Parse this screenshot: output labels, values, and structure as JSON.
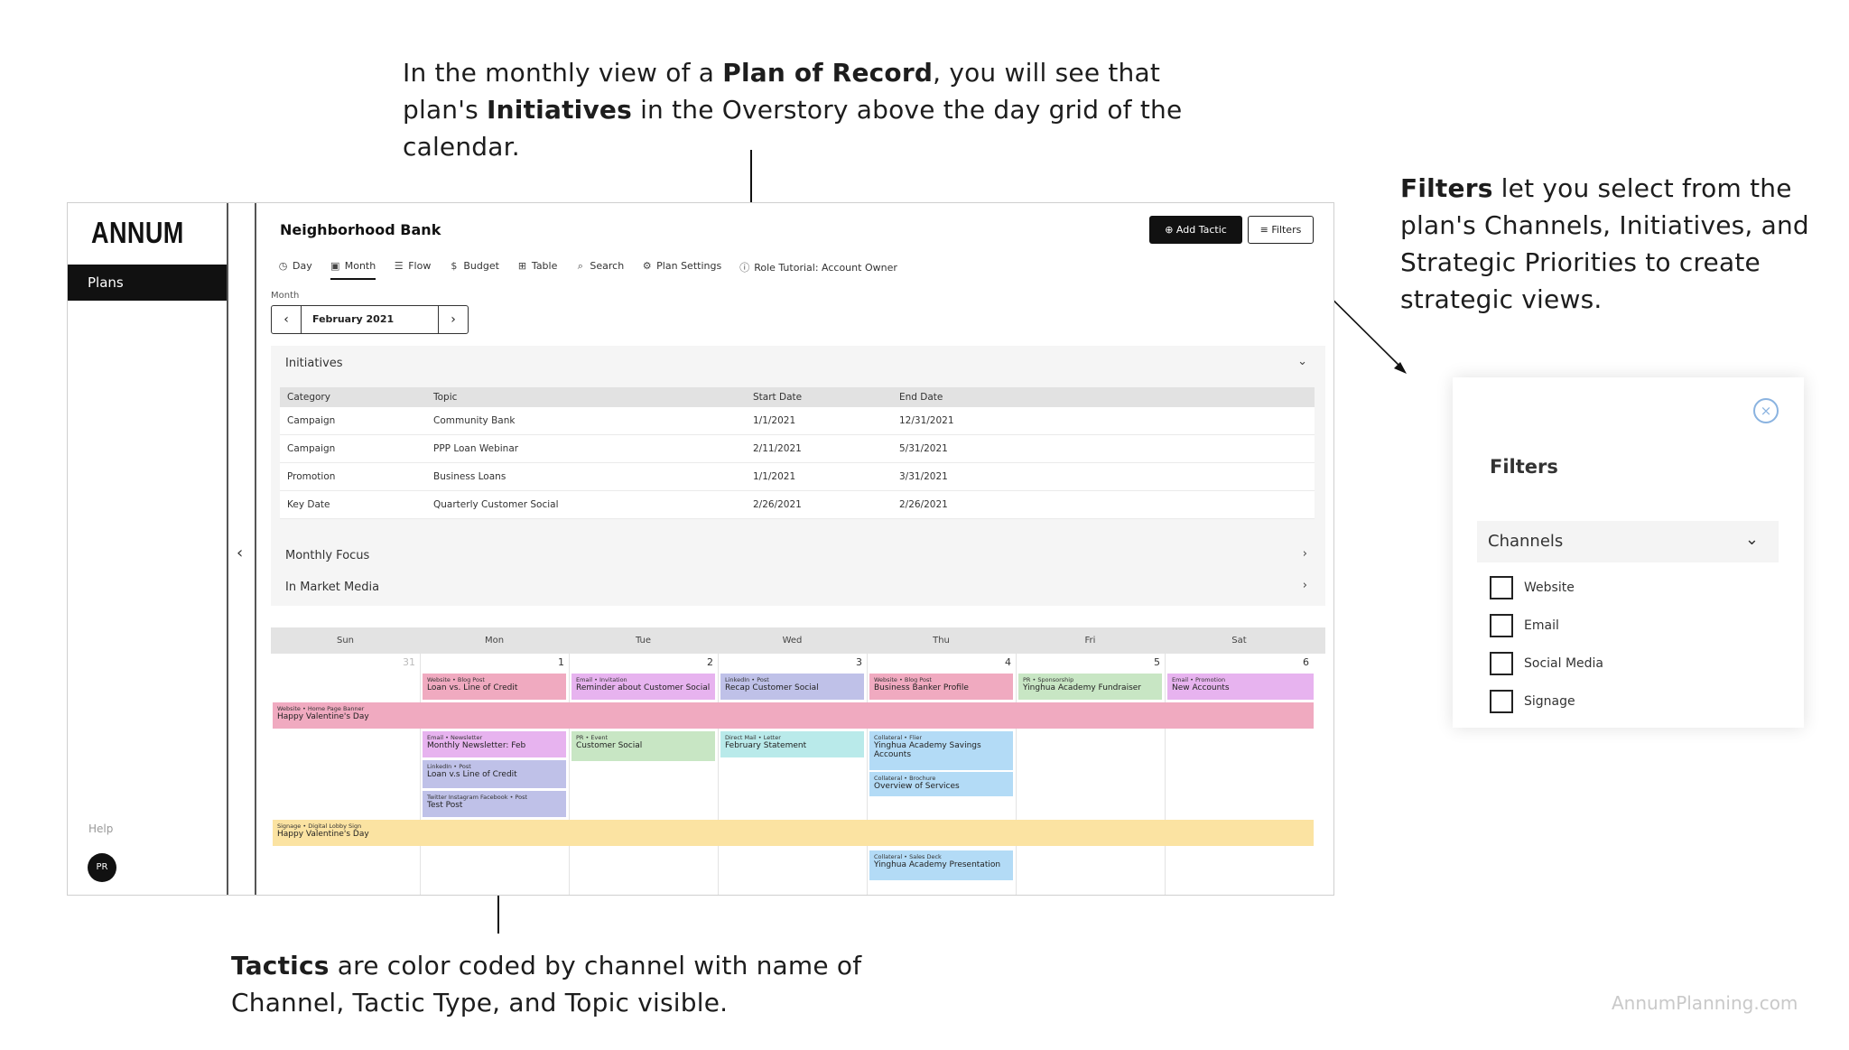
{
  "captions": {
    "top": {
      "p1": "In the monthly view of a ",
      "b1": "Plan of Record",
      "p2": ", you will see that plan's ",
      "b2": "Initiatives",
      "p3": " in the Overstory above the day grid of the calendar."
    },
    "right": {
      "b1": "Filters",
      "p1": " let you select from the plan's Channels, Initiatives, and Strategic Priorities to create strategic views."
    },
    "bottom": {
      "b1": "Tactics",
      "p1": " are color coded by channel with name of Channel, Tactic Type, and Topic visible."
    },
    "footer": "AnnumPlanning.com"
  },
  "app": {
    "logo": "ANNUM",
    "sidebar": {
      "plans": "Plans",
      "help": "Help",
      "avatar": "PR"
    },
    "collapse_icon": "‹",
    "org_name": "Neighborhood Bank",
    "add_tactic": "Add Tactic",
    "filters_button": "Filters",
    "tabs": [
      {
        "label": "Day",
        "icon": "clock-icon"
      },
      {
        "label": "Month",
        "icon": "calendar-icon",
        "active": true
      },
      {
        "label": "Flow",
        "icon": "flow-icon"
      },
      {
        "label": "Budget",
        "icon": "dollar-icon"
      },
      {
        "label": "Table",
        "icon": "table-icon"
      },
      {
        "label": "Search",
        "icon": "search-icon"
      },
      {
        "label": "Plan Settings",
        "icon": "gear-icon"
      },
      {
        "label": "Role Tutorial: Account Owner",
        "icon": "info-icon"
      }
    ],
    "month_label": "Month",
    "month_value": "February 2021",
    "overstory": {
      "initiatives_label": "Initiatives",
      "columns": [
        "Category",
        "Topic",
        "Start Date",
        "End Date"
      ],
      "rows": [
        [
          "Campaign",
          "Community Bank",
          "1/1/2021",
          "12/31/2021"
        ],
        [
          "Campaign",
          "PPP Loan Webinar",
          "2/11/2021",
          "5/31/2021"
        ],
        [
          "Promotion",
          "Business Loans",
          "1/1/2021",
          "3/31/2021"
        ],
        [
          "Key Date",
          "Quarterly Customer Social",
          "2/26/2021",
          "2/26/2021"
        ]
      ],
      "monthly_focus": "Monthly Focus",
      "in_market_media": "In Market Media"
    },
    "calendar": {
      "days_of_week": [
        "Sun",
        "Mon",
        "Tue",
        "Wed",
        "Thu",
        "Fri",
        "Sat"
      ],
      "day_numbers": [
        "31",
        "1",
        "2",
        "3",
        "4",
        "5",
        "6"
      ],
      "events": [
        {
          "type": "Website • Blog Post",
          "name": "Loan vs. Line of Credit",
          "color": "#f0aac0"
        },
        {
          "type": "Email • Invitation",
          "name": "Reminder about Customer Social",
          "color": "#e7b3ef"
        },
        {
          "type": "LinkedIn • Post",
          "name": "Recap Customer Social",
          "color": "#bfc1e8"
        },
        {
          "type": "Website • Blog Post",
          "name": "Business Banker Profile",
          "color": "#f0aac0"
        },
        {
          "type": "PR • Sponsorship",
          "name": "Yinghua Academy Fundraiser",
          "color": "#c8e6c4"
        },
        {
          "type": "Email • Promotion",
          "name": "New Accounts",
          "color": "#e7b3ef"
        },
        {
          "type": "Website • Home Page Banner",
          "name": "Happy Valentine's Day",
          "color": "#f0aac0"
        },
        {
          "type": "Email • Newsletter",
          "name": "Monthly Newsletter: Feb",
          "color": "#e7b3ef"
        },
        {
          "type": "PR • Event",
          "name": "Customer Social",
          "color": "#c8e6c4"
        },
        {
          "type": "Direct Mail • Letter",
          "name": "February Statement",
          "color": "#b9eaea"
        },
        {
          "type": "Collateral • Flier",
          "name": "Yinghua Academy Savings Accounts",
          "color": "#b3dbf6"
        },
        {
          "type": "LinkedIn • Post",
          "name": "Loan v.s Line of Credit",
          "color": "#bfc1e8"
        },
        {
          "type": "Collateral • Brochure",
          "name": "Overview of Services",
          "color": "#b3dbf6"
        },
        {
          "type": "Twitter Instagram Facebook • Post",
          "name": "Test Post",
          "color": "#bfc1e8"
        },
        {
          "type": "Signage • Digital Lobby Sign",
          "name": "Happy Valentine's Day",
          "color": "#fbe3a2"
        },
        {
          "type": "Collateral • Sales Deck",
          "name": "Yinghua Academy Presentation",
          "color": "#b3dbf6"
        }
      ]
    }
  },
  "filters_panel": {
    "close_icon": "×",
    "title": "Filters",
    "section": "Channels",
    "options": [
      "Website",
      "Email",
      "Social Media",
      "Signage"
    ]
  }
}
